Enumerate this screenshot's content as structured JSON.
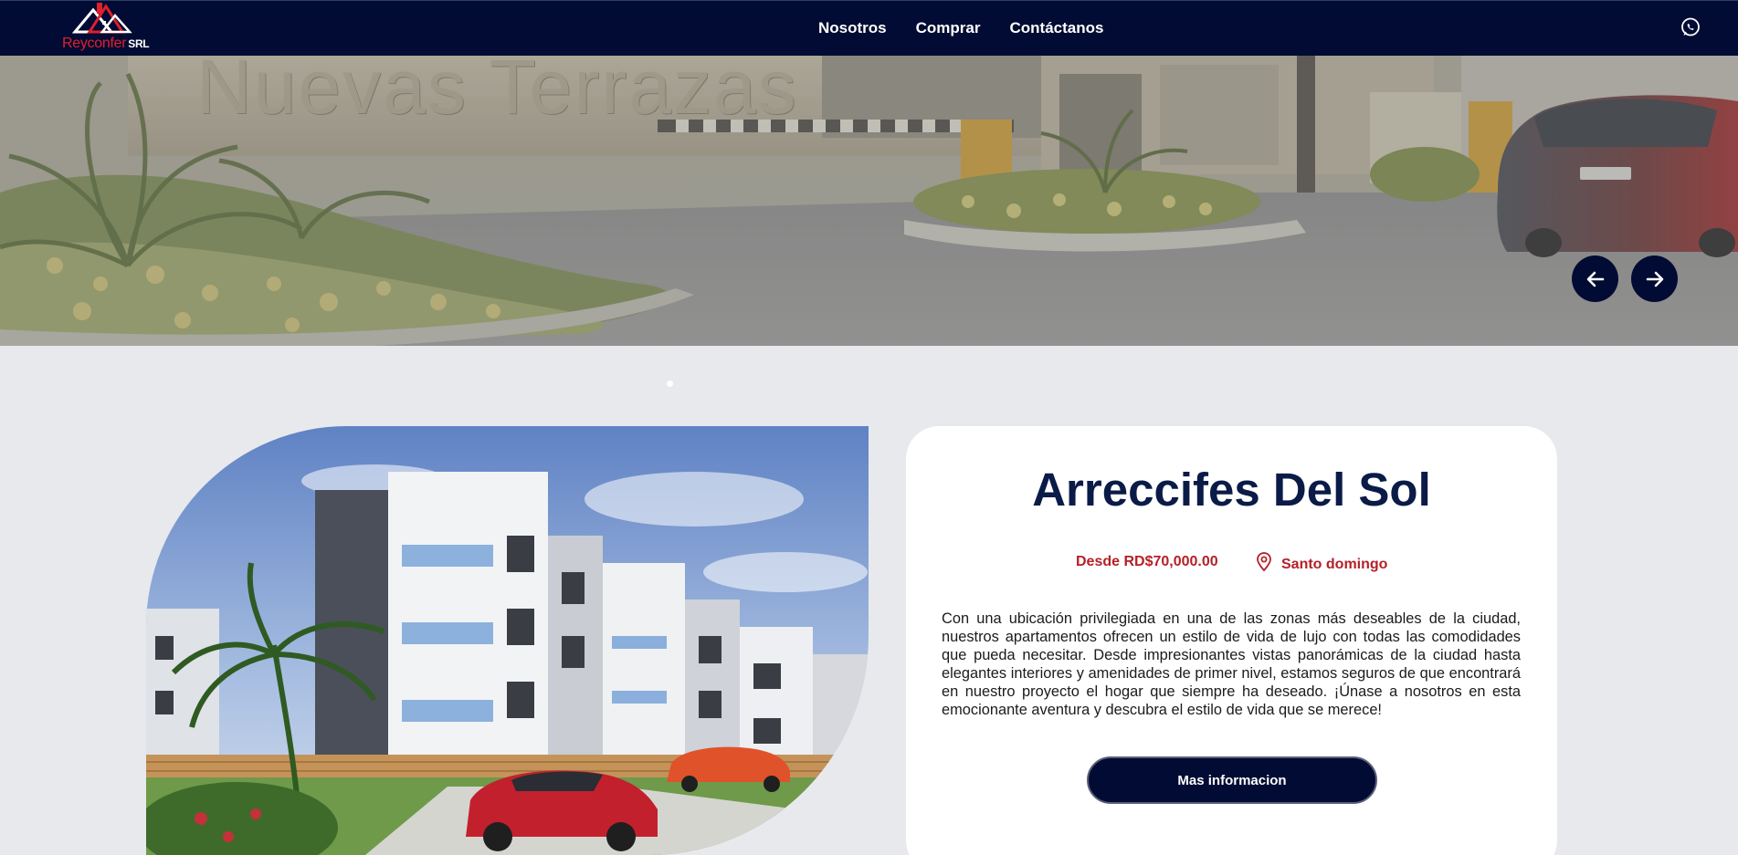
{
  "brand": {
    "name": "Reyconfer",
    "suffix": "SRL",
    "navy": "#020b33",
    "red": "#b52028"
  },
  "nav": {
    "links": [
      {
        "label": "Nosotros"
      },
      {
        "label": "Comprar"
      },
      {
        "label": "Contáctanos"
      }
    ],
    "whatsapp_icon": "whatsapp-icon"
  },
  "hero": {
    "sign_text": "Nuevas Terrazas",
    "prev_icon": "arrow-left-icon",
    "next_icon": "arrow-right-icon"
  },
  "project": {
    "title": "Arreccifes Del Sol",
    "price": "Desde RD$70,000.00",
    "location": "Santo domingo",
    "location_icon": "map-pin-icon",
    "description": "Con una ubicación privilegiada en una de las zonas más deseables de la ciudad, nuestros apartamentos ofrecen un estilo de vida de lujo con todas las comodidades que pueda necesitar. Desde impresionantes vistas panorámicas de la ciudad hasta elegantes interiores y amenidades de primer nivel, estamos seguros de que encontrará en nuestro proyecto el hogar que siempre ha deseado. ¡Únase a nosotros en esta emocionante aventura y descubra el estilo de vida que se merece!",
    "button_label": "Mas informacion"
  }
}
